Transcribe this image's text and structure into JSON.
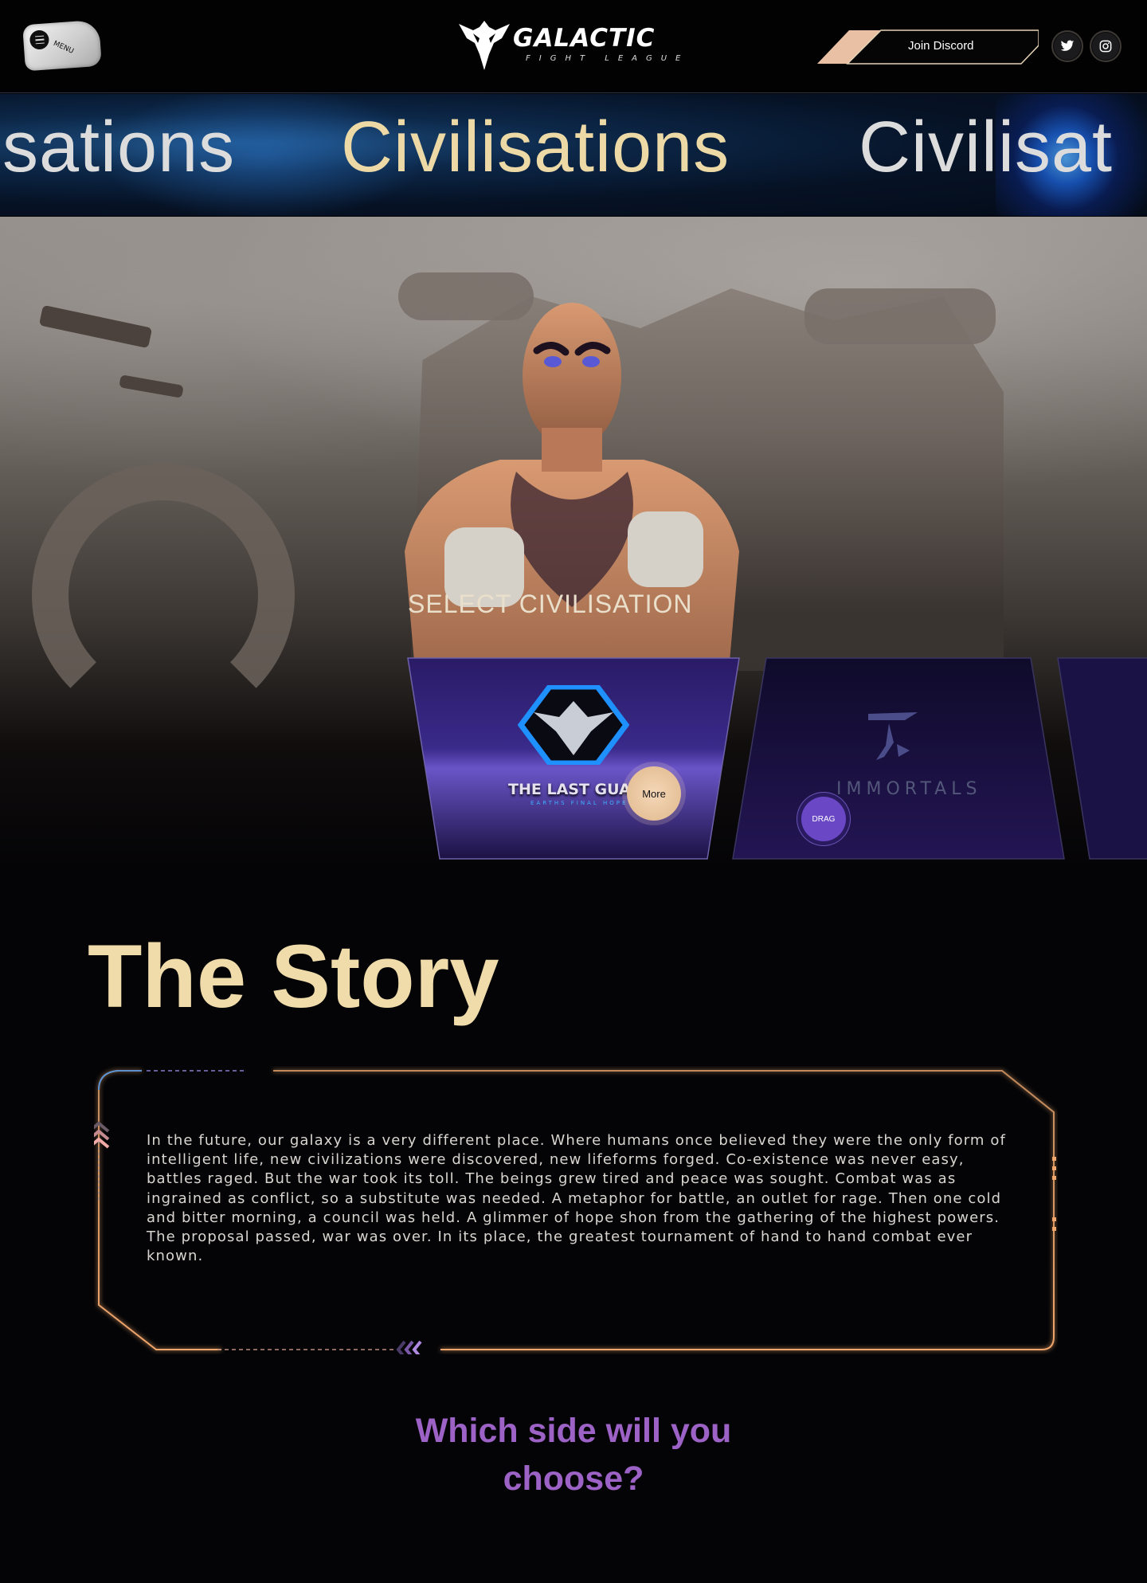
{
  "header": {
    "menu_label": "MENU",
    "logo_title": "GALACTIC",
    "logo_subtitle": "FIGHT LEAGUE",
    "discord_label": "Join Discord",
    "social": [
      "twitter-icon",
      "instagram-icon"
    ]
  },
  "marquee": {
    "items": [
      "isations",
      "Civilisations",
      "Civilisat"
    ],
    "highlight_color": "#ecd9a6"
  },
  "hero": {
    "select_title": "SELECT CIVILISATION",
    "cards": [
      {
        "name": "THE LAST GUARI",
        "tagline": "EARTHS FINAL HOPE",
        "button": "More"
      },
      {
        "name": "IMMORTALS",
        "button": "DRAG"
      }
    ]
  },
  "story": {
    "title": "The Story",
    "text": "In the future, our galaxy is a very different place. Where humans once believed they were the only form of intelligent life, new civilizations were discovered, new lifeforms forged. Co-existence was never easy, battles raged. But the war took its toll. The beings grew tired and peace was sought. Combat was as ingrained as conflict, so a substitute was needed. A metaphor for battle, an outlet for rage. Then one cold and bitter morning, a council was held. A glimmer of hope shon from the gathering of the highest powers. The proposal passed, war was over. In its place, the greatest tournament of hand to hand combat ever known."
  },
  "choose": {
    "line1": "Which side will you",
    "line2": "choose?"
  },
  "colors": {
    "gold": "#f0dcaa",
    "purple": "#9d62c6",
    "frame_orange": "#e8a066"
  }
}
